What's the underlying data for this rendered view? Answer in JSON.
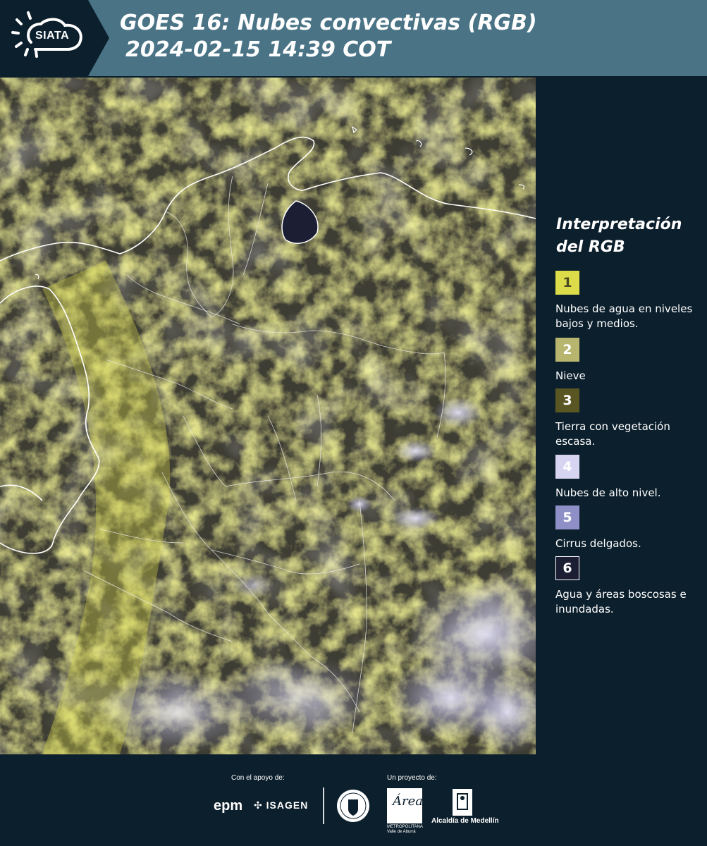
{
  "header": {
    "brand": "SIATA",
    "title_line1": "GOES 16: Nubes convectivas (RGB)",
    "title_line2": "2024-02-15 14:39 COT"
  },
  "legend": {
    "title": "Interpretación del RGB",
    "items": [
      {
        "number": "1",
        "label": "Nubes de agua en niveles bajos y medios.",
        "color": "#dcdc4a",
        "text_color": "#4a4a20"
      },
      {
        "number": "2",
        "label": "Nieve",
        "color": "#b8b56e",
        "text_color": "#ffffff"
      },
      {
        "number": "3",
        "label": "Tierra con vegetación escasa.",
        "color": "#5a5624",
        "text_color": "#ffffff"
      },
      {
        "number": "4",
        "label": "Nubes de alto nivel.",
        "color": "#d6d4f0",
        "text_color": "#ffffff"
      },
      {
        "number": "5",
        "label": "Cirrus delgados.",
        "color": "#8f8fc8",
        "text_color": "#ffffff"
      },
      {
        "number": "6",
        "label": "Agua y áreas boscosas e inundadas.",
        "color": "#1c1e34",
        "text_color": "#ffffff"
      }
    ]
  },
  "footer": {
    "support_label": "Con el apoyo de:",
    "project_label": "Un proyecto de:",
    "sponsor_epm": "epm",
    "sponsor_isagen": "ISAGEN",
    "partner_area_name": "Área",
    "partner_area_sub": "METROPOLITANA Valle de Aburrá",
    "partner_alcaldia": "Alcaldía de Medellín"
  },
  "colors": {
    "background": "#0c1f2c",
    "header": "#4a7486",
    "low_clouds": "#dcdc4a",
    "high_clouds": "#d6d4f0",
    "water": "#2a2e4a"
  }
}
